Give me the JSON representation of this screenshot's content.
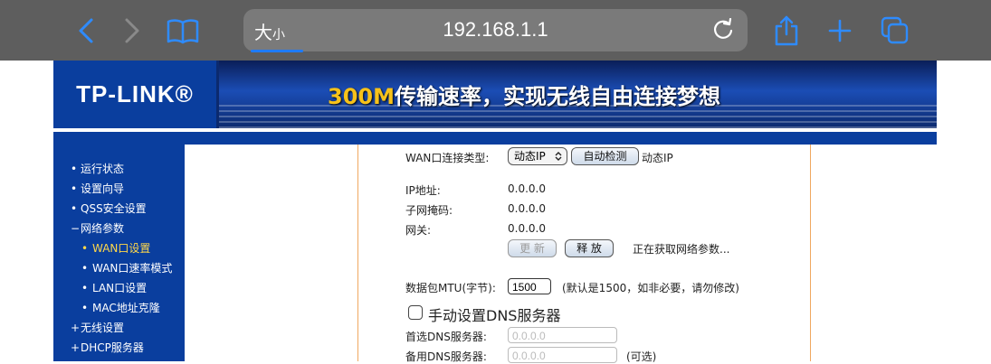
{
  "browser": {
    "size_label_big": "大",
    "size_label_small": "小",
    "url": "192.168.1.1"
  },
  "header": {
    "logo": "TP-LINK®",
    "slogan_number": "300M",
    "slogan_text": "传输速率，实现无线自由连接梦想"
  },
  "sidebar": {
    "items": [
      {
        "bullet": "•",
        "label": "运行状态"
      },
      {
        "bullet": "•",
        "label": "设置向导"
      },
      {
        "bullet": "•",
        "label": "QSS安全设置"
      },
      {
        "bullet": "−",
        "label": "网络参数"
      },
      {
        "bullet": "•",
        "label": "WAN口设置"
      },
      {
        "bullet": "•",
        "label": "WAN口速率模式"
      },
      {
        "bullet": "•",
        "label": "LAN口设置"
      },
      {
        "bullet": "•",
        "label": "MAC地址克隆"
      },
      {
        "bullet": "+",
        "label": "无线设置"
      },
      {
        "bullet": "+",
        "label": "DHCP服务器"
      }
    ]
  },
  "wan": {
    "conn_type_label": "WAN口连接类型:",
    "conn_type_value": "动态IP",
    "autodetect_button": "自动检测",
    "conn_type_desc": "动态IP",
    "ip_label": "IP地址:",
    "ip_value": "0.0.0.0",
    "mask_label": "子网掩码:",
    "mask_value": "0.0.0.0",
    "gateway_label": "网关:",
    "gateway_value": "0.0.0.0",
    "renew_button": "更 新",
    "release_button": "释 放",
    "status_text": "正在获取网络参数...",
    "mtu_label": "数据包MTU(字节):",
    "mtu_value": "1500",
    "mtu_hint": "(默认是1500，如非必要，请勿修改)",
    "manual_dns_label": "手动设置DNS服务器",
    "primary_dns_label": "首选DNS服务器:",
    "primary_dns_placeholder": "0.0.0.0",
    "secondary_dns_label": "备用DNS服务器:",
    "secondary_dns_placeholder": "0.0.0.0",
    "optional_label": "(可选)"
  },
  "colors": {
    "chrome_bg": "#5e5e5e",
    "sidebar_blue": "#0a3e9e",
    "active_item": "#ffd84a",
    "content_border": "#f0a860"
  }
}
